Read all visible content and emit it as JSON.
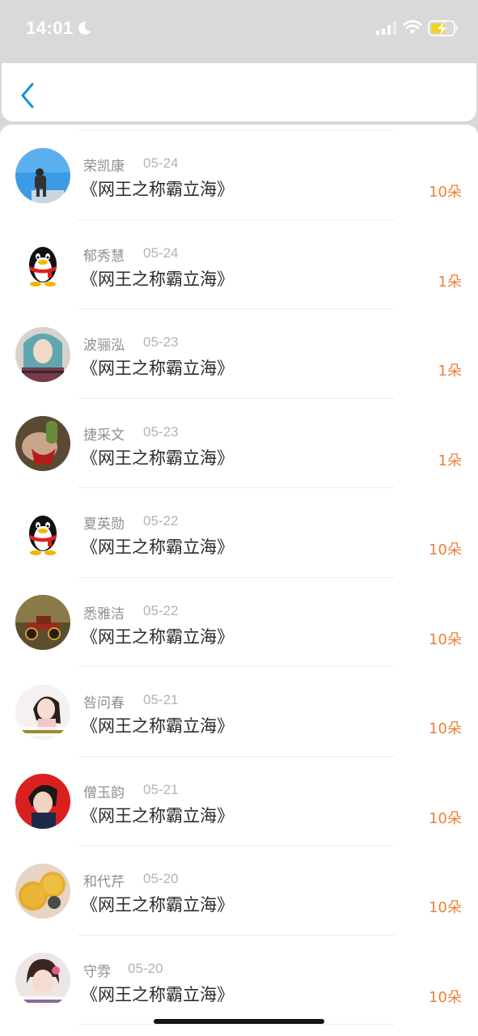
{
  "status_bar": {
    "time": "14:01"
  },
  "nav": {
    "back_icon": "chevron-left-icon"
  },
  "colors": {
    "accent": "#1a8fd6",
    "amount": "#e8823a"
  },
  "items": [
    {
      "name": "荣凯康",
      "date": "05-24",
      "title": "《网王之称霸立海》",
      "amount": "10朵",
      "avatar": "photo-blue-sky"
    },
    {
      "name": "郁秀慧",
      "date": "05-24",
      "title": "《网王之称霸立海》",
      "amount": "1朵",
      "avatar": "qq-penguin"
    },
    {
      "name": "波骊泓",
      "date": "05-23",
      "title": "《网王之称霸立海》",
      "amount": "1朵",
      "avatar": "photo-girl-teal-hair"
    },
    {
      "name": "捷采文",
      "date": "05-23",
      "title": "《网王之称霸立海》",
      "amount": "1朵",
      "avatar": "photo-hand-red"
    },
    {
      "name": "夏英勋",
      "date": "05-22",
      "title": "《网王之称霸立海》",
      "amount": "10朵",
      "avatar": "qq-penguin"
    },
    {
      "name": "悉雅洁",
      "date": "05-22",
      "title": "《网王之称霸立海》",
      "amount": "10朵",
      "avatar": "photo-toy-car"
    },
    {
      "name": "咎问春",
      "date": "05-21",
      "title": "《网王之称霸立海》",
      "amount": "10朵",
      "avatar": "photo-girl-caption"
    },
    {
      "name": "僧玉韵",
      "date": "05-21",
      "title": "《网王之称霸立海》",
      "amount": "10朵",
      "avatar": "photo-boy-red"
    },
    {
      "name": "和代芹",
      "date": "05-20",
      "title": "《网王之称霸立海》",
      "amount": "10朵",
      "avatar": "photo-pastry"
    },
    {
      "name": "守雰",
      "date": "05-20",
      "title": "《网王之称霸立海》",
      "amount": "10朵",
      "avatar": "photo-child-caption"
    }
  ]
}
